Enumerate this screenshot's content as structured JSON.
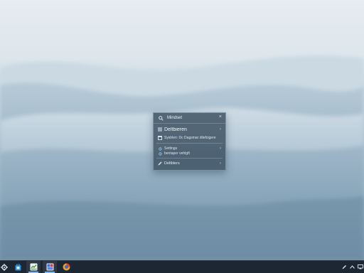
{
  "panel": {
    "title": "Mindset",
    "close_label": "×",
    "items": [
      {
        "label": "Deltbieren",
        "icon": "list-icon",
        "chevron": "›"
      },
      {
        "label": "Syslrlen: Dc Dagsmar dilefcigere",
        "icon": "window-icon"
      },
      {
        "label": "Settings",
        "icon": "gear-icon",
        "chevron": "›"
      },
      {
        "label": "bentaper vehlgft",
        "icon": "gear-icon"
      },
      {
        "label": "Deltblers",
        "icon": "pen-icon",
        "chevron": "›"
      }
    ]
  },
  "taskbar": {
    "items": [
      "settings-gear-icon",
      "store-icon",
      "notes-app-icon",
      "photos-app-icon",
      "browser-icon"
    ],
    "active_indices": [
      2,
      3
    ],
    "tray": [
      "pen-icon",
      "chevron-up-icon",
      "network-icon"
    ]
  },
  "colors": {
    "panel_bg": "#405464",
    "taskbar_bg": "#1d2733",
    "accent": "#7fb6e6"
  }
}
